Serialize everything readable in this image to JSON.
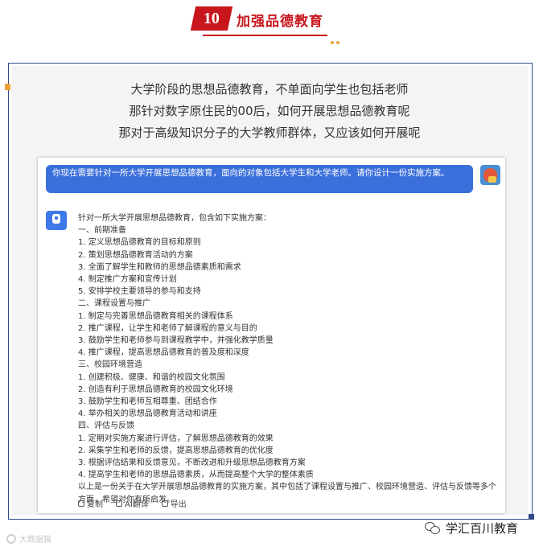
{
  "header": {
    "number": "10",
    "title": "加强品德教育"
  },
  "intro": {
    "lines": [
      "大学阶段的思想品德教育，不单面向学生也包括老师",
      "那针对数字原住民的00后，如何开展思想品德教育呢",
      "那对于高级知识分子的大学教师群体，又应该如何开展呢"
    ]
  },
  "chat": {
    "question": "你现在需要针对一所大学开展思想品德教育，面向的对象包括大学生和大学老师。请你设计一份实施方案。",
    "answer_lines": [
      "针对一所大学开展思想品德教育，包含如下实施方案：",
      "一、前期准备",
      "1. 定义思想品德教育的目标和原则",
      "2. 策划思想品德教育活动的方案",
      "3. 全面了解学生和教师的思想品德素质和需求",
      "4. 制定推广方案和宣传计划",
      "5. 安排学校主要领导的参与和支持",
      "二、课程设置与推广",
      "1. 制定与完善思想品德教育相关的课程体系",
      "2. 推广课程，让学生和老师了解课程的意义与目的",
      "3. 鼓励学生和老师参与到课程教学中，并强化教学质量",
      "4. 推广课程，提高思想品德教育的普及度和深度",
      "三、校园环境营造",
      "1. 创建积极、健康、和谐的校园文化氛围",
      "2. 创造有利于思想品德教育的校园文化环境",
      "3. 鼓励学生和老师互相尊重、团结合作",
      "4. 举办相关的思想品德教育活动和讲座",
      "四、评估与反馈",
      "1. 定期对实施方案进行评估，了解思想品德教育的效果",
      "2. 采集学生和老师的反馈，提高思想品德教育的优化度",
      "3. 根据评估结果和反馈意见，不断改进和升级思想品德教育方案",
      "4. 提高学生和老师的思想品德素质，从而提高整个大学的整体素质"
    ],
    "answer_summary": "以上是一份关于在大学开展思想品德教育的实施方案，其中包括了课程设置与推广、校园环境营造、评估与反馈等多个方面，希望对你有所启发。",
    "actions": {
      "copy": "复制",
      "translate": "AI翻译",
      "export": "导出"
    }
  },
  "footer": {
    "watermark": "大数据猫",
    "brand": "学汇百川教育"
  },
  "colors": {
    "accent_red": "#c8161d",
    "frame_blue": "#2f4a8a",
    "bubble_blue": "#3b6fdb",
    "corner_orange": "#f1a036"
  }
}
